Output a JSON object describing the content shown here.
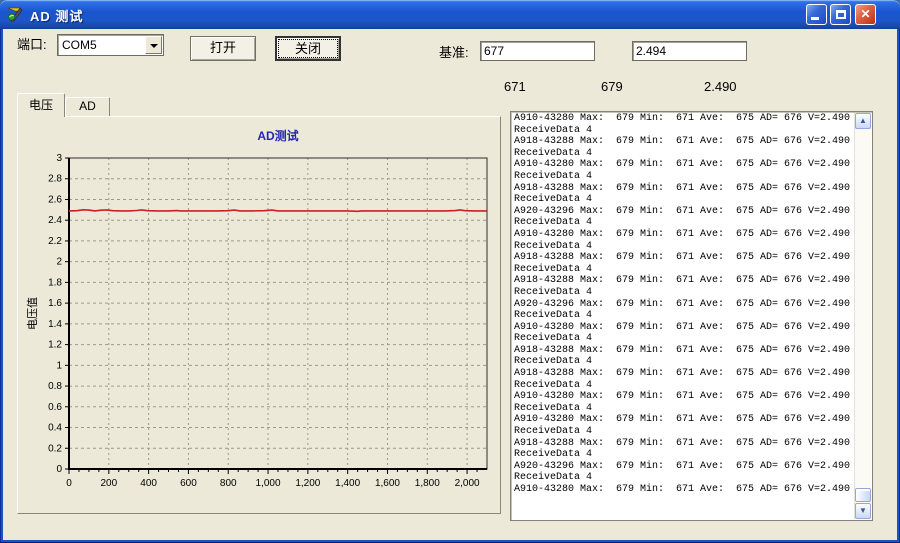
{
  "window": {
    "title": "AD 测试",
    "app_icon": "builder-flame-icon"
  },
  "toolbar": {
    "port_label": "端口:",
    "port_value": "COM5",
    "open_button": "打开",
    "close_button": "关闭",
    "baseline_label": "基准:",
    "baseline_ad_value": "677",
    "baseline_voltage_value": "2.494"
  },
  "readouts": {
    "values": [
      "671",
      "679",
      "2.490"
    ]
  },
  "tabs": [
    {
      "label": "电压",
      "active": true
    },
    {
      "label": "AD",
      "active": false
    }
  ],
  "chart_data": {
    "type": "line",
    "title": "AD测试",
    "title_color": "#2626B0",
    "xlabel": "",
    "ylabel": "电压值",
    "xlim": [
      0,
      2100
    ],
    "ylim": [
      0,
      3
    ],
    "x_ticks": [
      0,
      200,
      400,
      600,
      800,
      1000,
      1200,
      1400,
      1600,
      1800,
      2000
    ],
    "x_tick_labels": [
      "0",
      "200",
      "400",
      "600",
      "800",
      "1,000",
      "1,200",
      "1,400",
      "1,600",
      "1,800",
      "2,000"
    ],
    "y_ticks": [
      0,
      0.2,
      0.4,
      0.6,
      0.8,
      1,
      1.2,
      1.4,
      1.6,
      1.8,
      2,
      2.2,
      2.4,
      2.6,
      2.8,
      3
    ],
    "y_tick_labels": [
      "0",
      "0.2",
      "0.4",
      "0.6",
      "0.8",
      "1",
      "1.2",
      "1.4",
      "1.6",
      "1.8",
      "2",
      "2.2",
      "2.4",
      "2.6",
      "2.8",
      "3"
    ],
    "grid": "dashed",
    "legend": "none",
    "series": [
      {
        "name": "电压",
        "color": "#CC2020",
        "points": [
          [
            0,
            2.49
          ],
          [
            40,
            2.492
          ],
          [
            70,
            2.5
          ],
          [
            100,
            2.497
          ],
          [
            130,
            2.49
          ],
          [
            160,
            2.496
          ],
          [
            190,
            2.499
          ],
          [
            220,
            2.492
          ],
          [
            260,
            2.49
          ],
          [
            300,
            2.49
          ],
          [
            340,
            2.494
          ],
          [
            365,
            2.499
          ],
          [
            395,
            2.492
          ],
          [
            440,
            2.49
          ],
          [
            500,
            2.49
          ],
          [
            540,
            2.493
          ],
          [
            560,
            2.49
          ],
          [
            620,
            2.49
          ],
          [
            680,
            2.49
          ],
          [
            740,
            2.49
          ],
          [
            800,
            2.492
          ],
          [
            830,
            2.497
          ],
          [
            860,
            2.49
          ],
          [
            920,
            2.49
          ],
          [
            980,
            2.492
          ],
          [
            1020,
            2.497
          ],
          [
            1050,
            2.49
          ],
          [
            1120,
            2.49
          ],
          [
            1190,
            2.49
          ],
          [
            1260,
            2.49
          ],
          [
            1330,
            2.49
          ],
          [
            1400,
            2.49
          ],
          [
            1450,
            2.486
          ],
          [
            1470,
            2.49
          ],
          [
            1540,
            2.49
          ],
          [
            1610,
            2.49
          ],
          [
            1680,
            2.49
          ],
          [
            1750,
            2.49
          ],
          [
            1820,
            2.49
          ],
          [
            1890,
            2.49
          ],
          [
            1940,
            2.493
          ],
          [
            1965,
            2.499
          ],
          [
            1990,
            2.492
          ],
          [
            2040,
            2.49
          ],
          [
            2100,
            2.49
          ]
        ]
      }
    ]
  },
  "log": {
    "lines": [
      "A910-43280 Max:  679 Min:  671 Ave:  675 AD= 676 V=2.490",
      "ReceiveData 4",
      "A918-43288 Max:  679 Min:  671 Ave:  675 AD= 676 V=2.490",
      "ReceiveData 4",
      "A910-43280 Max:  679 Min:  671 Ave:  675 AD= 676 V=2.490",
      "ReceiveData 4",
      "A918-43288 Max:  679 Min:  671 Ave:  675 AD= 676 V=2.490",
      "ReceiveData 4",
      "A920-43296 Max:  679 Min:  671 Ave:  675 AD= 676 V=2.490",
      "ReceiveData 4",
      "A910-43280 Max:  679 Min:  671 Ave:  675 AD= 676 V=2.490",
      "ReceiveData 4",
      "A918-43288 Max:  679 Min:  671 Ave:  675 AD= 676 V=2.490",
      "ReceiveData 4",
      "A918-43288 Max:  679 Min:  671 Ave:  675 AD= 676 V=2.490",
      "ReceiveData 4",
      "A920-43296 Max:  679 Min:  671 Ave:  675 AD= 676 V=2.490",
      "ReceiveData 4",
      "A910-43280 Max:  679 Min:  671 Ave:  675 AD= 676 V=2.490",
      "ReceiveData 4",
      "A918-43288 Max:  679 Min:  671 Ave:  675 AD= 676 V=2.490",
      "ReceiveData 4",
      "A918-43288 Max:  679 Min:  671 Ave:  675 AD= 676 V=2.490",
      "ReceiveData 4",
      "A910-43280 Max:  679 Min:  671 Ave:  675 AD= 676 V=2.490",
      "ReceiveData 4",
      "A910-43280 Max:  679 Min:  671 Ave:  675 AD= 676 V=2.490",
      "ReceiveData 4",
      "A918-43288 Max:  679 Min:  671 Ave:  675 AD= 676 V=2.490",
      "ReceiveData 4",
      "A920-43296 Max:  679 Min:  671 Ave:  675 AD= 676 V=2.490",
      "ReceiveData 4",
      "A910-43280 Max:  679 Min:  671 Ave:  675 AD= 676 V=2.490"
    ]
  },
  "scrollbar": {
    "up_icon": "▲",
    "down_icon": "▼"
  }
}
